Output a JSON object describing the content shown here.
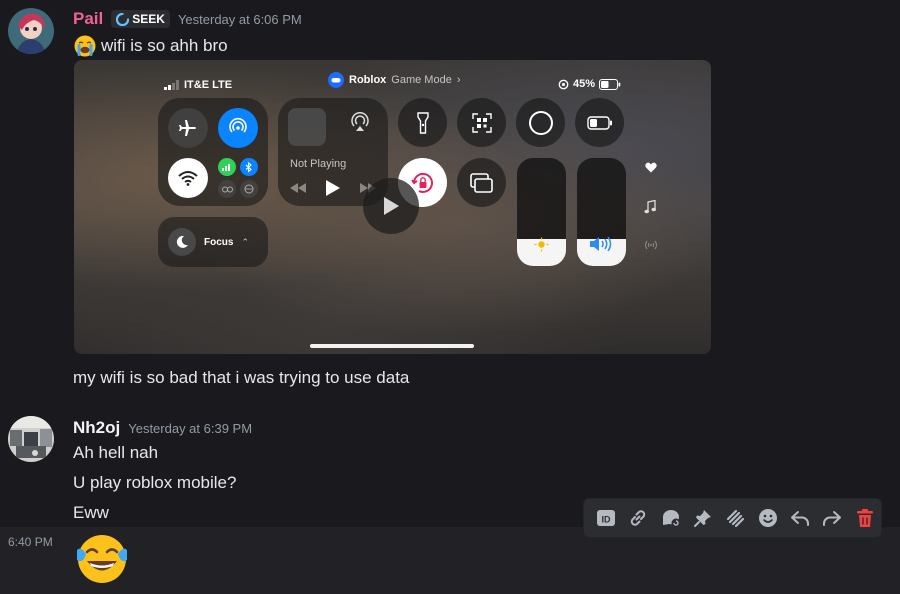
{
  "messages": [
    {
      "username": "Pail",
      "username_color": "#f06292",
      "tag": "SEEK",
      "timestamp": "Yesterday at 6:06 PM",
      "lines": [
        "wifi is so ahh bro",
        "my wifi is so bad that i was trying to use data"
      ]
    },
    {
      "username": "Nh2oj",
      "username_color": "#f2f3f5",
      "timestamp": "Yesterday at 6:39 PM",
      "lines": [
        "Ah hell nah",
        "U play roblox mobile?",
        "Eww"
      ]
    },
    {
      "side_timestamp": "6:40 PM",
      "emoji": "joy-emoji"
    }
  ],
  "attachment": {
    "carrier": "IT&E LTE",
    "app_name": "Roblox",
    "game_mode": "Game Mode",
    "battery": "45%",
    "now_playing": "Not Playing",
    "focus_label": "Focus",
    "brightness_level": 0.25,
    "volume_level": 0.25
  },
  "actions": [
    "id-icon",
    "link-icon",
    "thread-icon",
    "pin-icon",
    "apps-icon",
    "reaction-icon",
    "reply-icon",
    "forward-icon",
    "delete-icon"
  ],
  "colors": {
    "background": "#1a1a1e",
    "accent_blue": "#0a84ff",
    "delete_red": "#f23f42"
  }
}
